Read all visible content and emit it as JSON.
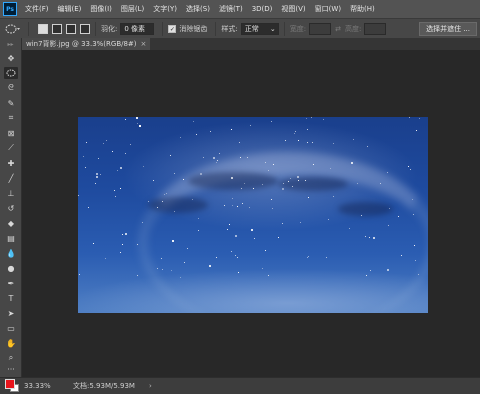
{
  "app": {
    "logo_text": "Ps"
  },
  "menu": [
    "文件(F)",
    "编辑(E)",
    "图像(I)",
    "图层(L)",
    "文字(Y)",
    "选择(S)",
    "滤镜(T)",
    "3D(D)",
    "视图(V)",
    "窗口(W)",
    "帮助(H)"
  ],
  "options": {
    "feather_label": "羽化:",
    "feather_value": "0 像素",
    "antialias_label": "消除锯齿",
    "antialias_checked": true,
    "style_label": "样式:",
    "style_value": "正常",
    "width_label": "宽度:",
    "height_label": "高度:",
    "select_mask_label": "选择并遮住 ..."
  },
  "document": {
    "tab_title": "win7背影.jpg @ 33.3%(RGB/8#)",
    "tab_close": "×"
  },
  "status": {
    "zoom": "33.33%",
    "doc_info": "文档:5.93M/5.93M",
    "arrow": "›"
  },
  "colors": {
    "foreground": "#e8141c",
    "background": "#ffffff",
    "accent": "#31a8ff"
  },
  "tools": [
    "move-icon",
    "marquee-icon",
    "lasso-icon",
    "quick-select-icon",
    "crop-icon",
    "frame-icon",
    "eyedropper-icon",
    "healing-icon",
    "brush-icon",
    "stamp-icon",
    "history-brush-icon",
    "eraser-icon",
    "gradient-icon",
    "blur-icon",
    "dodge-icon",
    "pen-icon",
    "text-icon",
    "path-select-icon",
    "rectangle-icon",
    "hand-icon",
    "zoom-icon",
    "more-icon"
  ]
}
